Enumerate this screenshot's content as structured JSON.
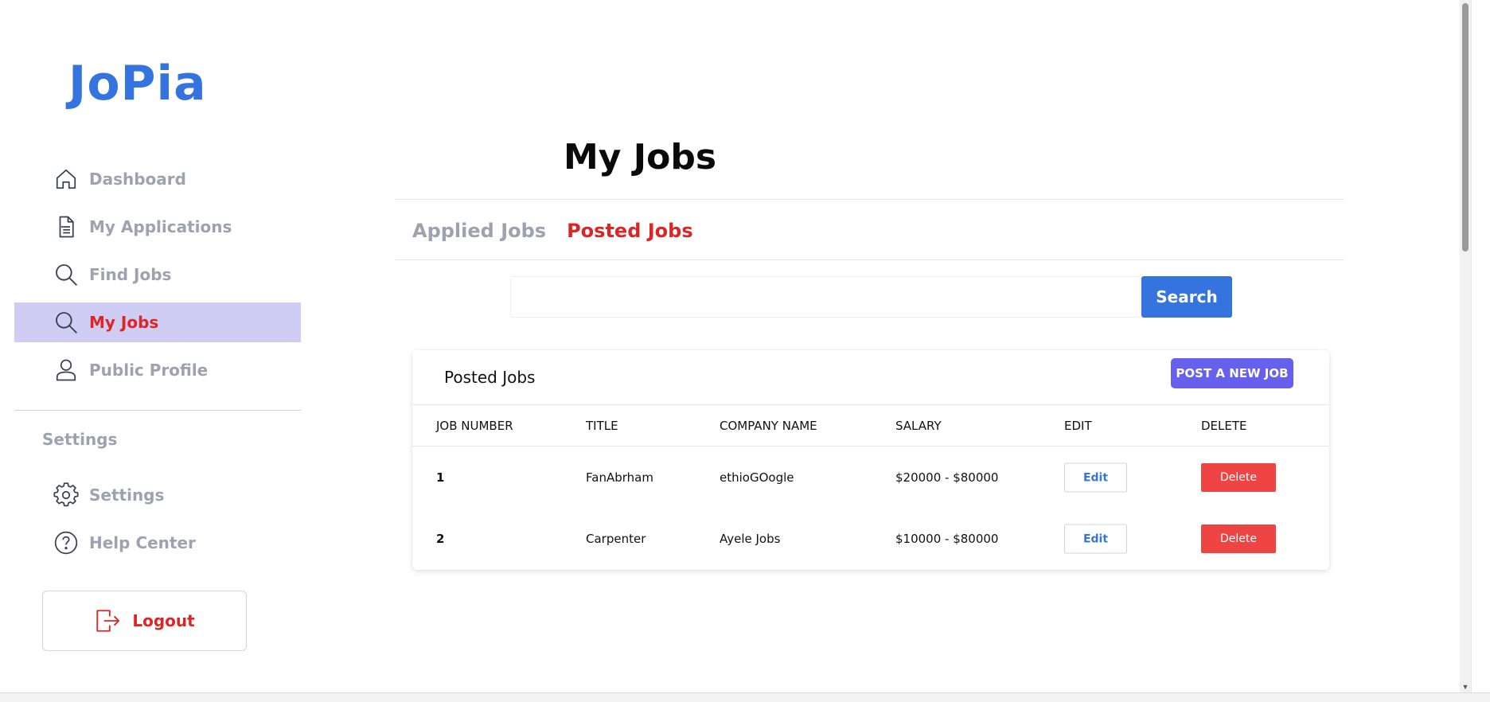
{
  "app": {
    "logo": "JoPia"
  },
  "sidebar": {
    "items": [
      {
        "label": "Dashboard",
        "icon": "home-icon"
      },
      {
        "label": "My Applications",
        "icon": "document-icon"
      },
      {
        "label": "Find Jobs",
        "icon": "search-icon"
      },
      {
        "label": "My Jobs",
        "icon": "search-icon",
        "active": true
      },
      {
        "label": "Public Profile",
        "icon": "user-icon"
      }
    ],
    "settings_heading": "Settings",
    "settings_items": [
      {
        "label": "Settings",
        "icon": "gear-icon"
      },
      {
        "label": "Help Center",
        "icon": "help-circle-icon"
      }
    ],
    "logout_label": "Logout"
  },
  "main": {
    "title": "My Jobs",
    "tabs": [
      {
        "label": "Applied Jobs",
        "active": false
      },
      {
        "label": "Posted Jobs",
        "active": true
      }
    ],
    "search": {
      "value": "",
      "placeholder": "",
      "button_label": "Search"
    },
    "card": {
      "title": "Posted Jobs",
      "post_button": "POST A NEW JOB",
      "columns": [
        "JOB NUMBER",
        "TITLE",
        "COMPANY NAME",
        "SALARY",
        "EDIT",
        "DELETE"
      ],
      "rows": [
        {
          "number": "1",
          "title": "FanAbrham",
          "company": "ethioGOogle",
          "salary": "$20000 - $80000",
          "edit": "Edit",
          "delete": "Delete"
        },
        {
          "number": "2",
          "title": "Carpenter",
          "company": "Ayele Jobs",
          "salary": "$10000 - $80000",
          "edit": "Edit",
          "delete": "Delete"
        }
      ]
    }
  },
  "colors": {
    "brand": "#3574de",
    "active_nav_bg": "#cfcdf4",
    "danger": "#dc2626",
    "delete_button": "#ef4444",
    "post_button": "#6660ec",
    "muted_text": "#9ca3af"
  }
}
